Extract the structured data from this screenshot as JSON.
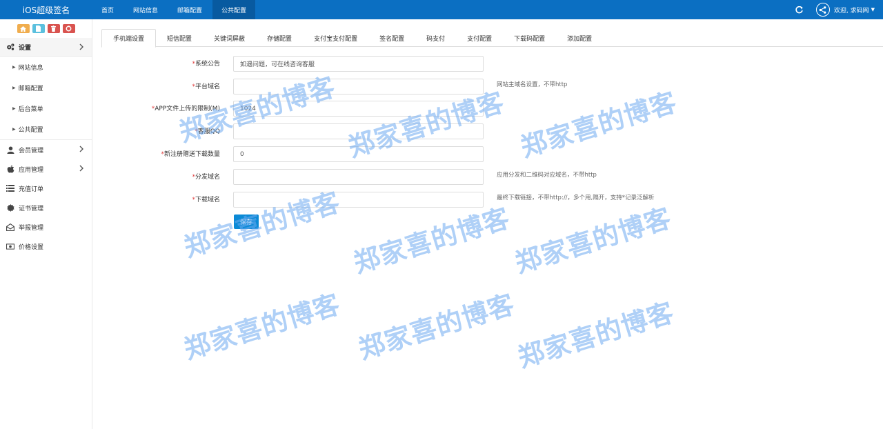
{
  "app": {
    "title": "iOS超级签名"
  },
  "topnav": {
    "items": [
      {
        "label": "首页"
      },
      {
        "label": "网站信息"
      },
      {
        "label": "邮箱配置"
      },
      {
        "label": "公共配置"
      }
    ],
    "active_index": 3
  },
  "user": {
    "greeting": "欢迎, 求码网"
  },
  "sidebar": {
    "shortcut_icons": [
      "home-icon",
      "file-icon",
      "trash-icon",
      "recycle-icon"
    ],
    "settings": {
      "label": "设置",
      "icon": "gears-icon"
    },
    "settings_sub": [
      {
        "label": "网站信息"
      },
      {
        "label": "邮箱配置"
      },
      {
        "label": "后台菜单"
      },
      {
        "label": "公共配置"
      }
    ],
    "items": [
      {
        "label": "会员管理",
        "icon": "user-icon",
        "has_arrow": true
      },
      {
        "label": "应用管理",
        "icon": "apple-icon",
        "has_arrow": true
      },
      {
        "label": "充值订单",
        "icon": "list-icon",
        "has_arrow": false
      },
      {
        "label": "证书管理",
        "icon": "certificate-icon",
        "has_arrow": false
      },
      {
        "label": "举报管理",
        "icon": "envelope-open-icon",
        "has_arrow": false
      },
      {
        "label": "价格设置",
        "icon": "money-icon",
        "has_arrow": false
      }
    ]
  },
  "tabs": [
    {
      "label": "手机端设置"
    },
    {
      "label": "短信配置"
    },
    {
      "label": "关键词屏蔽"
    },
    {
      "label": "存储配置"
    },
    {
      "label": "支付宝支付配置"
    },
    {
      "label": "签名配置"
    },
    {
      "label": "码支付"
    },
    {
      "label": "支付配置"
    },
    {
      "label": "下载码配置"
    },
    {
      "label": "添加配置"
    }
  ],
  "active_tab": 0,
  "form": {
    "required_mark": "*",
    "fields": [
      {
        "label": "系统公告",
        "value": "如遇问题，可在线咨询客服",
        "hint": ""
      },
      {
        "label": "平台域名",
        "value": "",
        "hint": "网站主域名设置，不带http"
      },
      {
        "label": "APP文件上传的限制(M)",
        "value": "1024",
        "hint": ""
      },
      {
        "label": "客服QQ",
        "value": "",
        "hint": ""
      },
      {
        "label": "新注册赠送下载数量",
        "value": "0",
        "hint": ""
      },
      {
        "label": "分发域名",
        "value": "",
        "hint": "应用分发和二维码对应域名，不带http"
      },
      {
        "label": "下载域名",
        "value": "",
        "hint": "最终下载链接，不带http://，多个用,隔开，支持*记录泛解析"
      }
    ],
    "save_label": "保存"
  },
  "watermark": {
    "text": "郑家喜的博客"
  },
  "colors": {
    "topbar": "#0b6fc2",
    "topnav_active": "#085aa0",
    "primary_button": "#0b8ad6",
    "required": "#e04040",
    "watermark": "#6eaaf0"
  }
}
